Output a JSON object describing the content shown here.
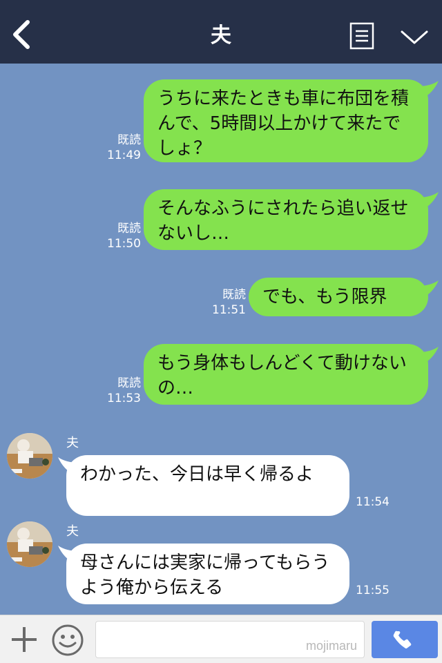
{
  "header": {
    "title": "夫",
    "back_icon": "chevron-left-icon",
    "note_icon": "note-icon",
    "dropdown_icon": "chevron-down-icon",
    "bg_color": "#263048"
  },
  "chat": {
    "bg_color": "#7293c2",
    "messages": [
      {
        "from": "me",
        "text": "うちに来たときも車に布団を積んで、5時間以上かけて来たでしょ？",
        "read": "既読",
        "time": "11:49"
      },
      {
        "from": "me",
        "text": "そんなふうにされたら追い返せないし…",
        "read": "既読",
        "time": "11:50"
      },
      {
        "from": "me",
        "text": "でも、もう限界",
        "read": "既読",
        "time": "11:51"
      },
      {
        "from": "me",
        "text": "もう身体もしんどくて動けないの…",
        "read": "既読",
        "time": "11:53"
      },
      {
        "from": "them",
        "sender": "夫",
        "text": "わかった、今日は早く帰るよ",
        "time": "11:54"
      },
      {
        "from": "them",
        "sender": "夫",
        "text": "母さんには実家に帰ってもらうよう俺から伝える",
        "time": "11:55"
      }
    ]
  },
  "footer": {
    "plus_icon": "plus-icon",
    "emoji_icon": "smile-icon",
    "input_value": "",
    "watermark": "mojimaru",
    "call_icon": "phone-icon"
  },
  "colors": {
    "my_bubble": "#84e24e",
    "their_bubble": "#ffffff",
    "call_button": "#5a87e4"
  }
}
